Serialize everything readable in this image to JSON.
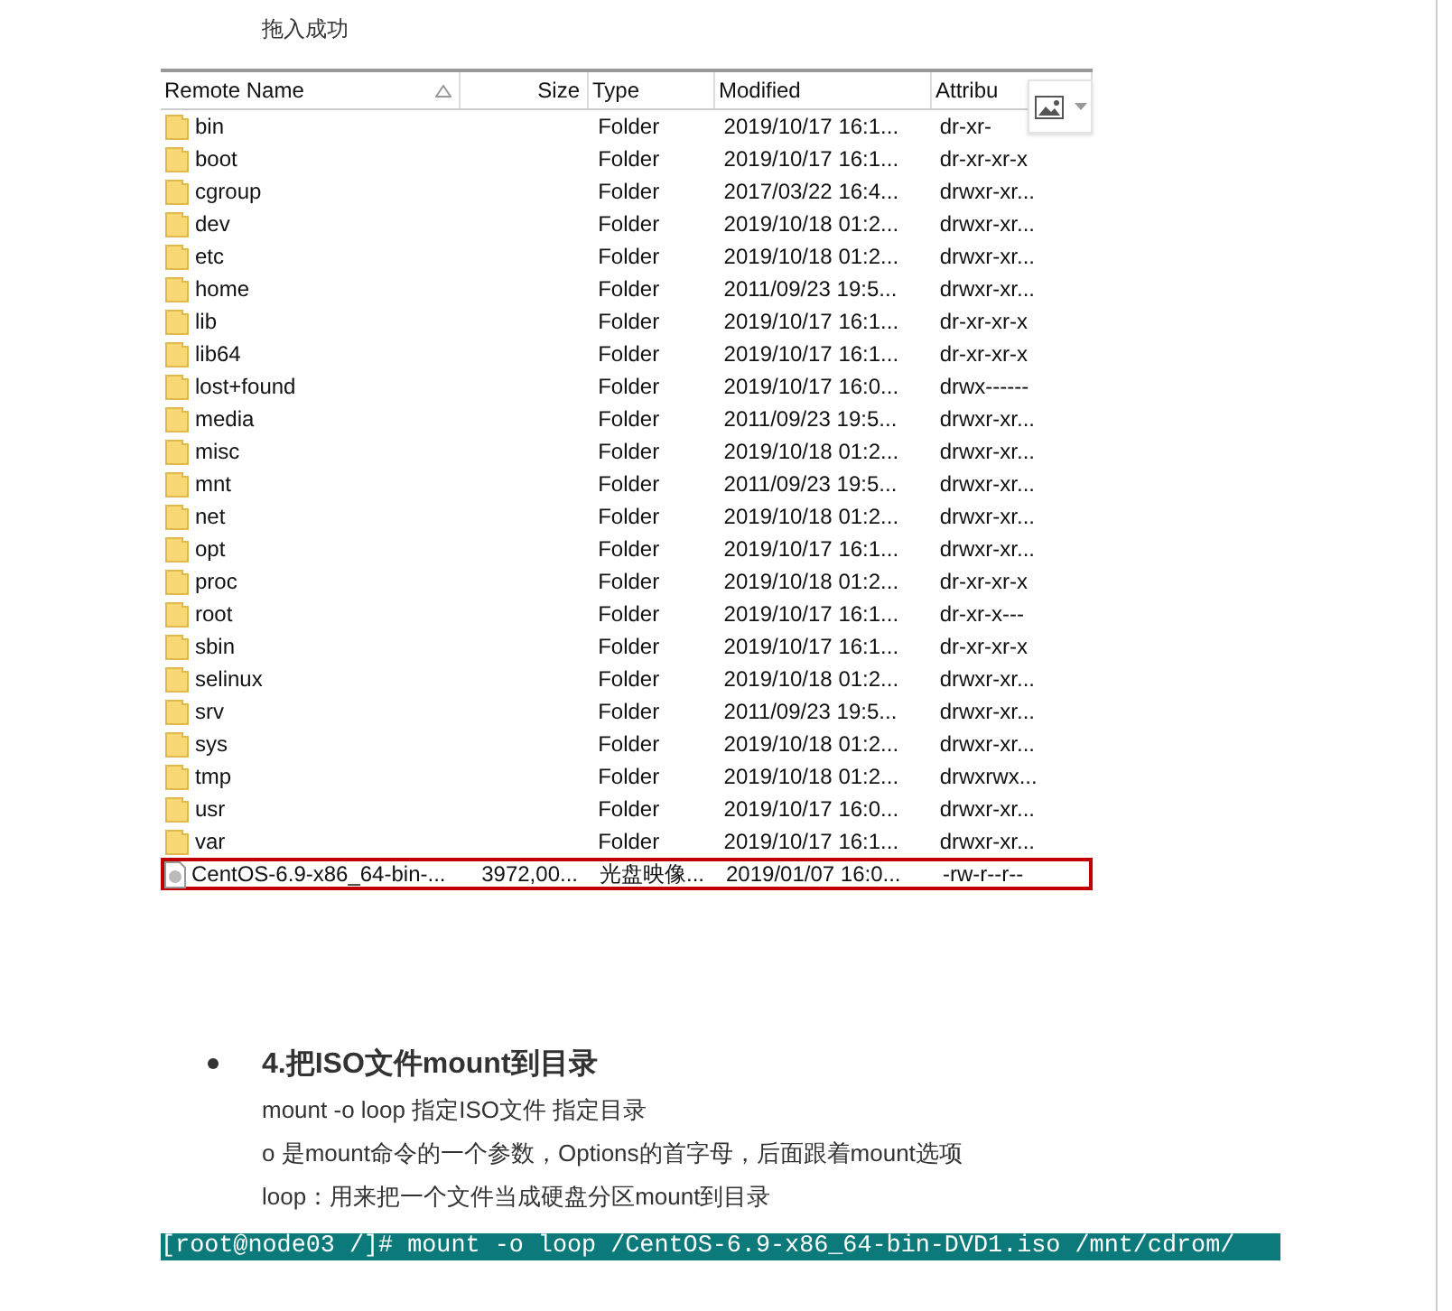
{
  "caption": "拖入成功",
  "file_table": {
    "columns": [
      {
        "label": "Remote Name",
        "sorted": true
      },
      {
        "label": "Size",
        "sorted": false
      },
      {
        "label": "Type",
        "sorted": false
      },
      {
        "label": "Modified",
        "sorted": false
      },
      {
        "label": "Attribu",
        "sorted": false
      }
    ],
    "rows": [
      {
        "kind": "folder",
        "highlighted": false,
        "cells": [
          "bin",
          "",
          "Folder",
          "2019/10/17 16:1...",
          "dr-xr-"
        ]
      },
      {
        "kind": "folder",
        "highlighted": false,
        "cells": [
          "boot",
          "",
          "Folder",
          "2019/10/17 16:1...",
          "dr-xr-xr-x"
        ]
      },
      {
        "kind": "folder",
        "highlighted": false,
        "cells": [
          "cgroup",
          "",
          "Folder",
          "2017/03/22 16:4...",
          "drwxr-xr..."
        ]
      },
      {
        "kind": "folder",
        "highlighted": false,
        "cells": [
          "dev",
          "",
          "Folder",
          "2019/10/18 01:2...",
          "drwxr-xr..."
        ]
      },
      {
        "kind": "folder",
        "highlighted": false,
        "cells": [
          "etc",
          "",
          "Folder",
          "2019/10/18 01:2...",
          "drwxr-xr..."
        ]
      },
      {
        "kind": "folder",
        "highlighted": false,
        "cells": [
          "home",
          "",
          "Folder",
          "2011/09/23 19:5...",
          "drwxr-xr..."
        ]
      },
      {
        "kind": "folder",
        "highlighted": false,
        "cells": [
          "lib",
          "",
          "Folder",
          "2019/10/17 16:1...",
          "dr-xr-xr-x"
        ]
      },
      {
        "kind": "folder",
        "highlighted": false,
        "cells": [
          "lib64",
          "",
          "Folder",
          "2019/10/17 16:1...",
          "dr-xr-xr-x"
        ]
      },
      {
        "kind": "folder",
        "highlighted": false,
        "cells": [
          "lost+found",
          "",
          "Folder",
          "2019/10/17 16:0...",
          "drwx------"
        ]
      },
      {
        "kind": "folder",
        "highlighted": false,
        "cells": [
          "media",
          "",
          "Folder",
          "2011/09/23 19:5...",
          "drwxr-xr..."
        ]
      },
      {
        "kind": "folder",
        "highlighted": false,
        "cells": [
          "misc",
          "",
          "Folder",
          "2019/10/18 01:2...",
          "drwxr-xr..."
        ]
      },
      {
        "kind": "folder",
        "highlighted": false,
        "cells": [
          "mnt",
          "",
          "Folder",
          "2011/09/23 19:5...",
          "drwxr-xr..."
        ]
      },
      {
        "kind": "folder",
        "highlighted": false,
        "cells": [
          "net",
          "",
          "Folder",
          "2019/10/18 01:2...",
          "drwxr-xr..."
        ]
      },
      {
        "kind": "folder",
        "highlighted": false,
        "cells": [
          "opt",
          "",
          "Folder",
          "2019/10/17 16:1...",
          "drwxr-xr..."
        ]
      },
      {
        "kind": "folder",
        "highlighted": false,
        "cells": [
          "proc",
          "",
          "Folder",
          "2019/10/18 01:2...",
          "dr-xr-xr-x"
        ]
      },
      {
        "kind": "folder",
        "highlighted": false,
        "cells": [
          "root",
          "",
          "Folder",
          "2019/10/17 16:1...",
          "dr-xr-x---"
        ]
      },
      {
        "kind": "folder",
        "highlighted": false,
        "cells": [
          "sbin",
          "",
          "Folder",
          "2019/10/17 16:1...",
          "dr-xr-xr-x"
        ]
      },
      {
        "kind": "folder",
        "highlighted": false,
        "cells": [
          "selinux",
          "",
          "Folder",
          "2019/10/18 01:2...",
          "drwxr-xr..."
        ]
      },
      {
        "kind": "folder",
        "highlighted": false,
        "cells": [
          "srv",
          "",
          "Folder",
          "2011/09/23 19:5...",
          "drwxr-xr..."
        ]
      },
      {
        "kind": "folder",
        "highlighted": false,
        "cells": [
          "sys",
          "",
          "Folder",
          "2019/10/18 01:2...",
          "drwxr-xr..."
        ]
      },
      {
        "kind": "folder",
        "highlighted": false,
        "cells": [
          "tmp",
          "",
          "Folder",
          "2019/10/18 01:2...",
          "drwxrwx..."
        ]
      },
      {
        "kind": "folder",
        "highlighted": false,
        "cells": [
          "usr",
          "",
          "Folder",
          "2019/10/17 16:0...",
          "drwxr-xr..."
        ]
      },
      {
        "kind": "folder",
        "highlighted": false,
        "cells": [
          "var",
          "",
          "Folder",
          "2019/10/17 16:1...",
          "drwxr-xr..."
        ]
      },
      {
        "kind": "file",
        "highlighted": true,
        "cells": [
          "CentOS-6.9-x86_64-bin-...",
          "3972,00...",
          "光盘映像...",
          "2019/01/07 16:0...",
          "-rw-r--r--"
        ]
      }
    ]
  },
  "section": {
    "heading": "4.把ISO文件mount到目录",
    "paragraphs": [
      "mount -o loop 指定ISO文件  指定目录",
      "o 是mount命令的一个参数，Options的首字母，后面跟着mount选项",
      "loop：用来把一个文件当成硬盘分区mount到目录"
    ]
  },
  "terminal_line": "[root@node03 /]# mount -o loop /CentOS-6.9-x86_64-bin-DVD1.iso  /mnt/cdrom/"
}
